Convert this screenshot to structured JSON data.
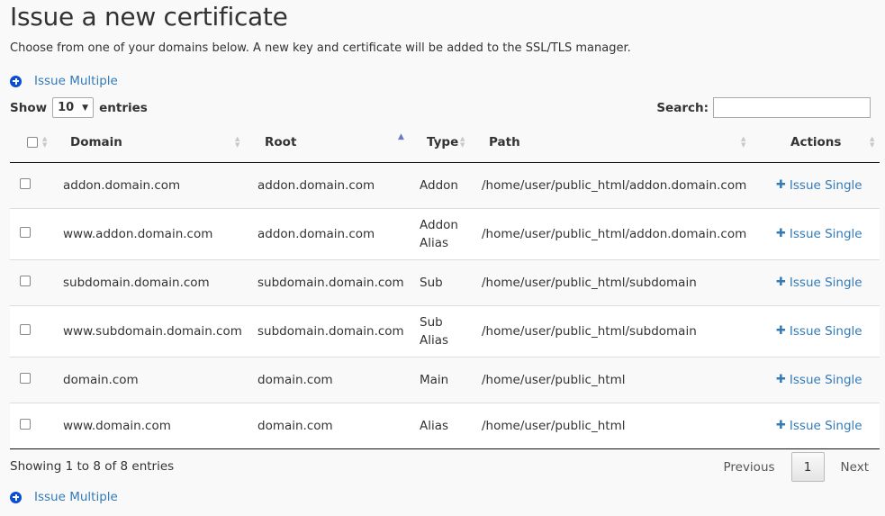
{
  "page": {
    "title": "Issue a new certificate",
    "description": "Choose from one of your domains below. A new key and certificate will be added to the SSL/TLS manager.",
    "issue_multiple_label": "Issue Multiple"
  },
  "controls": {
    "show_label": "Show",
    "entries_value": "10",
    "entries_label": "entries",
    "search_label": "Search:",
    "search_value": ""
  },
  "table": {
    "headers": {
      "domain": "Domain",
      "root": "Root",
      "type": "Type",
      "path": "Path",
      "actions": "Actions"
    },
    "action_label": "Issue Single",
    "rows": [
      {
        "domain": "addon.domain.com",
        "root": "addon.domain.com",
        "type": [
          "Addon"
        ],
        "path": "/home/user/public_html/addon.domain.com"
      },
      {
        "domain": "www.addon.domain.com",
        "root": "addon.domain.com",
        "type": [
          "Addon",
          "Alias"
        ],
        "path": "/home/user/public_html/addon.domain.com"
      },
      {
        "domain": "subdomain.domain.com",
        "root": "subdomain.domain.com",
        "type": [
          "Sub"
        ],
        "path": "/home/user/public_html/subdomain"
      },
      {
        "domain": "www.subdomain.domain.com",
        "root": "subdomain.domain.com",
        "type": [
          "Sub",
          "Alias"
        ],
        "path": "/home/user/public_html/subdomain"
      },
      {
        "domain": "domain.com",
        "root": "domain.com",
        "type": [
          "Main"
        ],
        "path": "/home/user/public_html"
      },
      {
        "domain": "www.domain.com",
        "root": "domain.com",
        "type": [
          "Alias"
        ],
        "path": "/home/user/public_html"
      }
    ]
  },
  "footer": {
    "info": "Showing 1 to 8 of 8 entries",
    "previous": "Previous",
    "page": "1",
    "next": "Next"
  },
  "colors": {
    "link": "#337ab7",
    "icon_circle": "#0a4ed8",
    "sort_active": "#6a78c6"
  }
}
